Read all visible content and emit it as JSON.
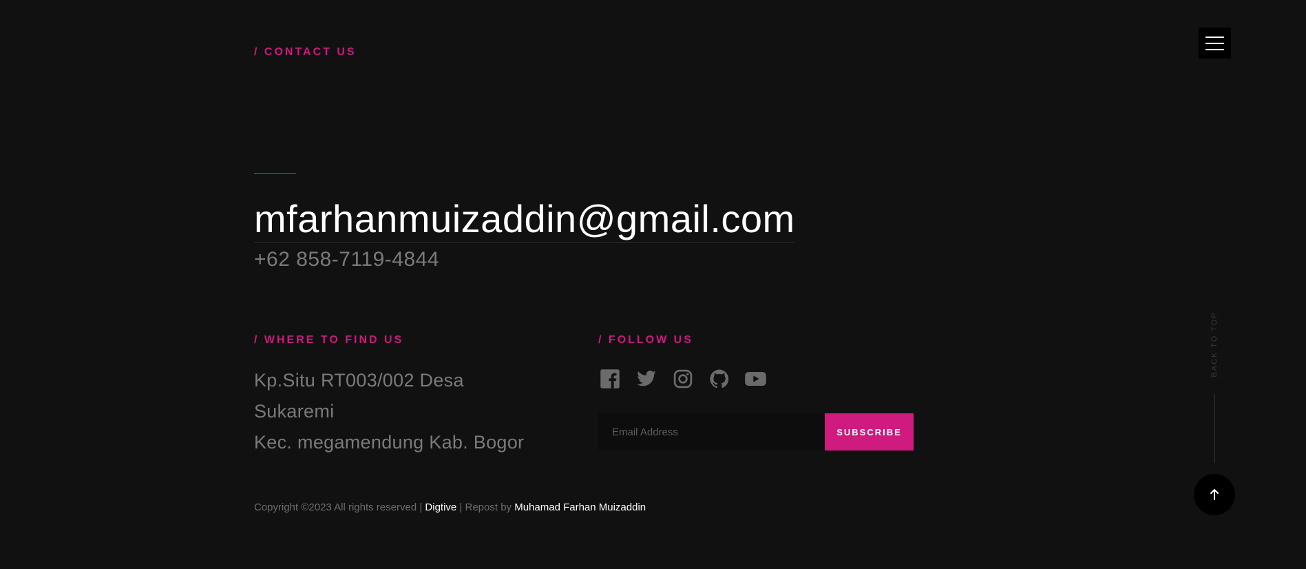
{
  "contact": {
    "label": "/ CONTACT US",
    "email": "mfarhanmuizaddin@gmail.com",
    "phone": "+62 858-7119-4844"
  },
  "where": {
    "label": "/ WHERE TO FIND US",
    "address_lines": [
      "Kp.Situ RT003/002 Desa",
      "Sukaremi",
      "Kec. megamendung Kab. Bogor"
    ]
  },
  "follow": {
    "label": "/ FOLLOW US",
    "icons": [
      "facebook-icon",
      "twitter-icon",
      "instagram-icon",
      "github-icon",
      "youtube-icon"
    ],
    "email_placeholder": "Email Address",
    "subscribe_label": "SUBSCRIBE"
  },
  "footer": {
    "copyright_prefix": "Copyright ©2023 All rights reserved | ",
    "brand": "Digtive",
    "repost_prefix": " | Repost by ",
    "author": "Muhamad Farhan Muizaddin"
  },
  "nav": {
    "menu_icon": "hamburger-menu-icon",
    "back_to_top_label": "BACK TO TOP",
    "back_icon": "arrow-up-icon"
  },
  "colors": {
    "background": "#111111",
    "accent": "#cf1a7f",
    "muted_text": "#7a7a7a",
    "icon": "#6b6b6b"
  }
}
